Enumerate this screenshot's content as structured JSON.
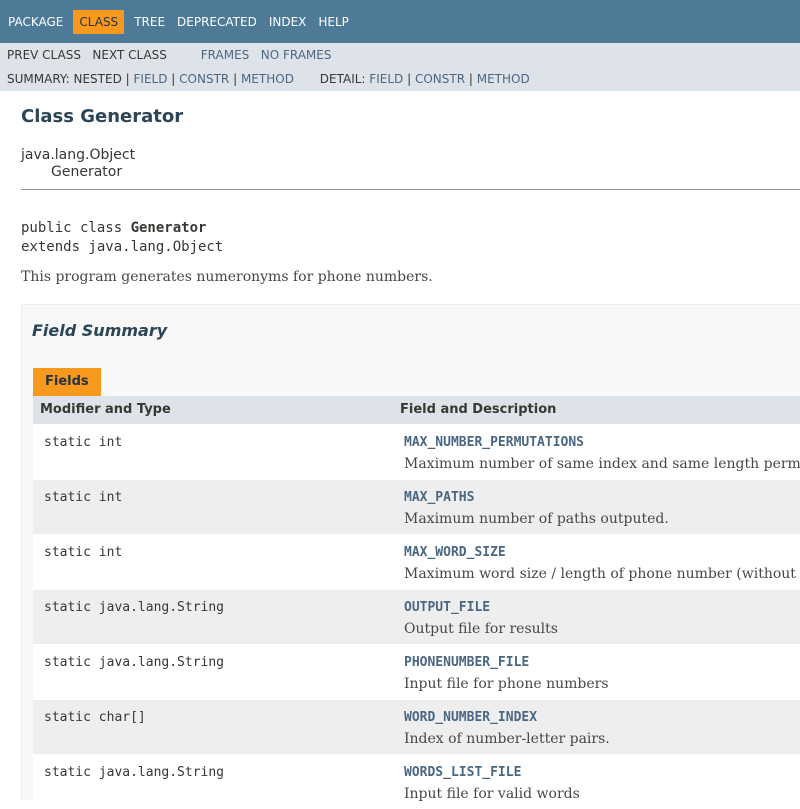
{
  "topnav": {
    "items": [
      "PACKAGE",
      "CLASS",
      "TREE",
      "DEPRECATED",
      "INDEX",
      "HELP"
    ],
    "active": "CLASS"
  },
  "subnav": {
    "prev_class": "PREV CLASS",
    "next_class": "NEXT CLASS",
    "frames": "FRAMES",
    "no_frames": "NO FRAMES",
    "summary_label": "SUMMARY: NESTED |",
    "summary_field": "FIELD",
    "summary_constr": "CONSTR",
    "summary_method": "METHOD",
    "detail_label": "DETAIL:",
    "detail_field": "FIELD",
    "detail_constr": "CONSTR",
    "detail_method": "METHOD",
    "separator": "|"
  },
  "header": {
    "title": "Class Generator",
    "parent": "java.lang.Object",
    "child": "Generator"
  },
  "declaration": {
    "line1_prefix": "public class ",
    "class_name": "Generator",
    "line2": "extends java.lang.Object"
  },
  "description": "This program generates numeronyms for phone numbers.",
  "field_summary": {
    "heading": "Field Summary",
    "caption": "Fields",
    "col_modifier": "Modifier and Type",
    "col_field": "Field and Description",
    "rows": [
      {
        "type": "static int",
        "name": "MAX_NUMBER_PERMUTATIONS",
        "desc": "Maximum number of same index and same length perm"
      },
      {
        "type": "static int",
        "name": "MAX_PATHS",
        "desc": "Maximum number of paths outputed."
      },
      {
        "type": "static int",
        "name": "MAX_WORD_SIZE",
        "desc": "Maximum word size / length of phone number (without"
      },
      {
        "type": "static java.lang.String",
        "name": "OUTPUT_FILE",
        "desc": "Output file for results"
      },
      {
        "type": "static java.lang.String",
        "name": "PHONENUMBER_FILE",
        "desc": "Input file for phone numbers"
      },
      {
        "type": "static char[]",
        "name": "WORD_NUMBER_INDEX",
        "desc": "Index of number-letter pairs."
      },
      {
        "type": "static java.lang.String",
        "name": "WORDS_LIST_FILE",
        "desc": "Input file for valid words"
      }
    ]
  },
  "colors": {
    "nav_bg": "#4d7a97",
    "active_tab": "#f8981d",
    "subnav_bg": "#dee3e9",
    "link": "#4a6782"
  }
}
